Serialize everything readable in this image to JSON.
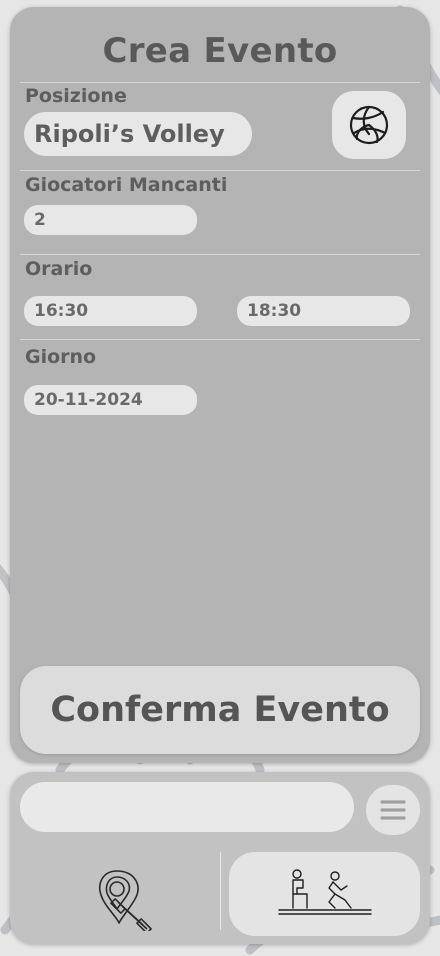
{
  "form": {
    "title": "Crea Evento",
    "position": {
      "label": "Posizione",
      "value": "Ripoli’s Volley"
    },
    "missing_players": {
      "label": "Giocatori Mancanti",
      "value": "2"
    },
    "time": {
      "label": "Orario",
      "start": "16:30",
      "end": "18:30"
    },
    "day": {
      "label": "Giorno",
      "value": "20-11-2024"
    },
    "confirm_label": "Conferma Evento"
  },
  "icons": {
    "sport": "volleyball-icon",
    "menu": "hamburger-menu-icon",
    "nav_left": "gym-location-pin-icon",
    "nav_right": "athletes-training-icon"
  },
  "colors": {
    "panel": "#b4b4b4",
    "field": "#e7e7e7",
    "text": "#5e5e5e",
    "bottom_bar": "#c2c2c2"
  }
}
